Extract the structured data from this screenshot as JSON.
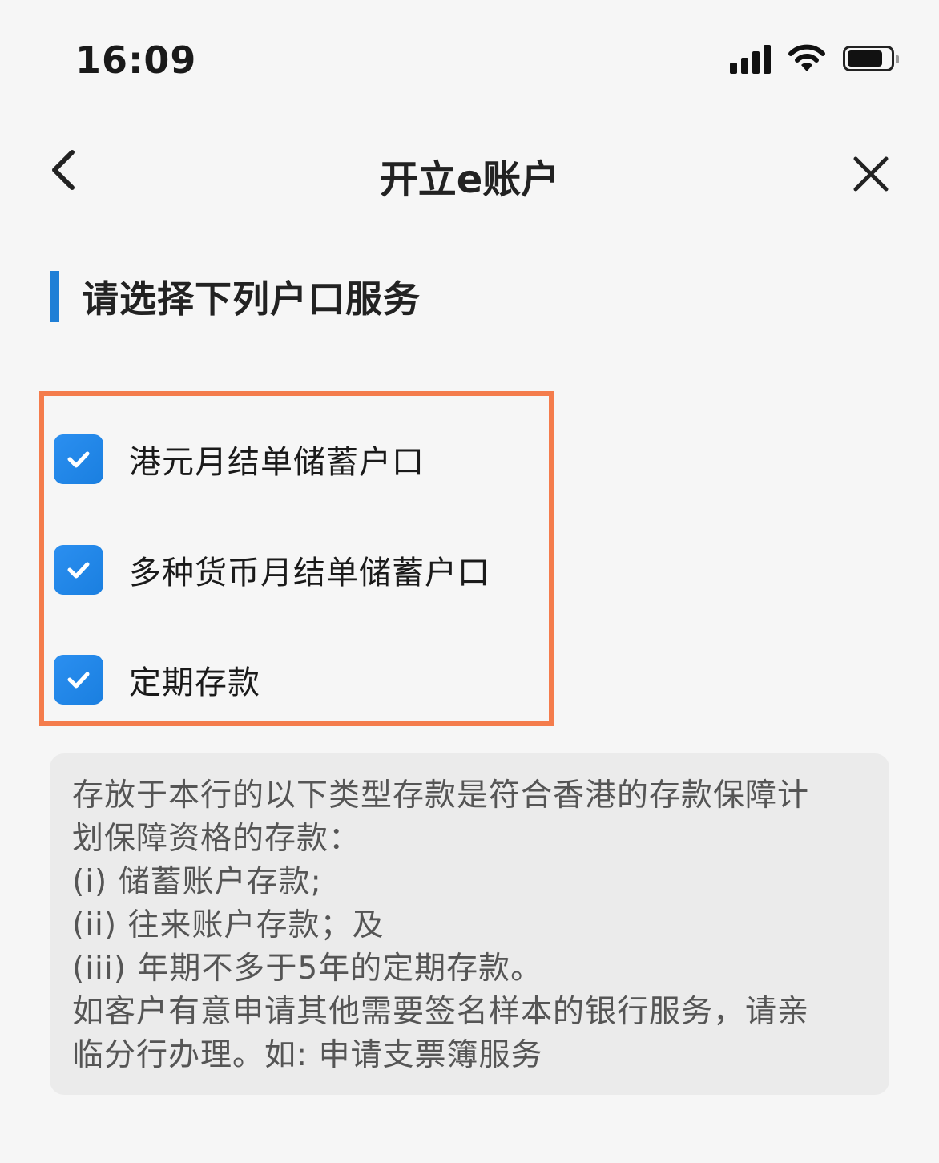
{
  "status_bar": {
    "time": "16:09"
  },
  "nav": {
    "title": "开立e账户"
  },
  "section": {
    "title": "请选择下列户口服务"
  },
  "options": [
    {
      "label": "港元月结单储蓄户口",
      "checked": true
    },
    {
      "label": "多种货币月结单储蓄户口",
      "checked": true
    },
    {
      "label": "定期存款",
      "checked": true
    }
  ],
  "info": {
    "lines": [
      "存放于本行的以下类型存款是符合香港的存款保障计",
      "划保障资格的存款：",
      "(i) 储蓄账户存款;",
      "(ii) 往来账户存款；及",
      "(iii) 年期不多于5年的定期存款。",
      "如客户有意申请其他需要签名样本的银行服务，请亲",
      "临分行办理。如: 申请支票簿服务"
    ]
  },
  "colors": {
    "accent": "#1f7fd6",
    "highlight": "#f47c4c",
    "checkbox": "#2b8ff0"
  }
}
